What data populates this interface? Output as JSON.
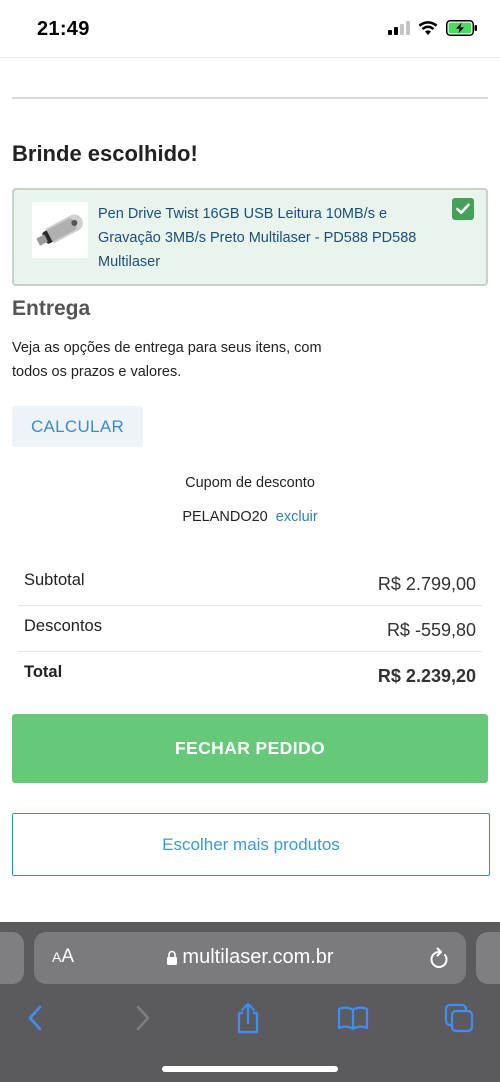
{
  "status_bar": {
    "time": "21:49",
    "icons": [
      "cellular-signal-icon",
      "wifi-icon",
      "battery-charging-icon"
    ],
    "battery_color": "#4cd964"
  },
  "gift": {
    "heading": "Brinde escolhido!",
    "product_name": "Pen Drive Twist 16GB USB Leitura 10MB/s e Gravação 3MB/s Preto Multilaser - PD588 PD588 Multilaser",
    "selected": true,
    "check_color": "#45a15a"
  },
  "delivery": {
    "title": "Entrega",
    "description": "Veja as opções de entrega para seus itens, com todos os prazos e valores.",
    "calculate_label": "CALCULAR"
  },
  "coupon": {
    "label": "Cupom de desconto",
    "code": "PELANDO20",
    "remove_label": "excluir"
  },
  "summary": {
    "rows": [
      {
        "label": "Subtotal",
        "value": "R$ 2.799,00"
      },
      {
        "label": "Descontos",
        "value": "R$ -559,80"
      },
      {
        "label": "Total",
        "value": "R$ 2.239,20"
      }
    ]
  },
  "actions": {
    "checkout_label": "FECHAR PEDIDO",
    "checkout_color": "#66c97a",
    "more_products_label": "Escolher mais produtos"
  },
  "browser": {
    "aa_label": "AA",
    "url": "multilaser.com.br",
    "toolbar_icons": [
      "back-icon",
      "forward-icon",
      "share-icon",
      "bookmarks-icon",
      "tabs-icon"
    ]
  }
}
